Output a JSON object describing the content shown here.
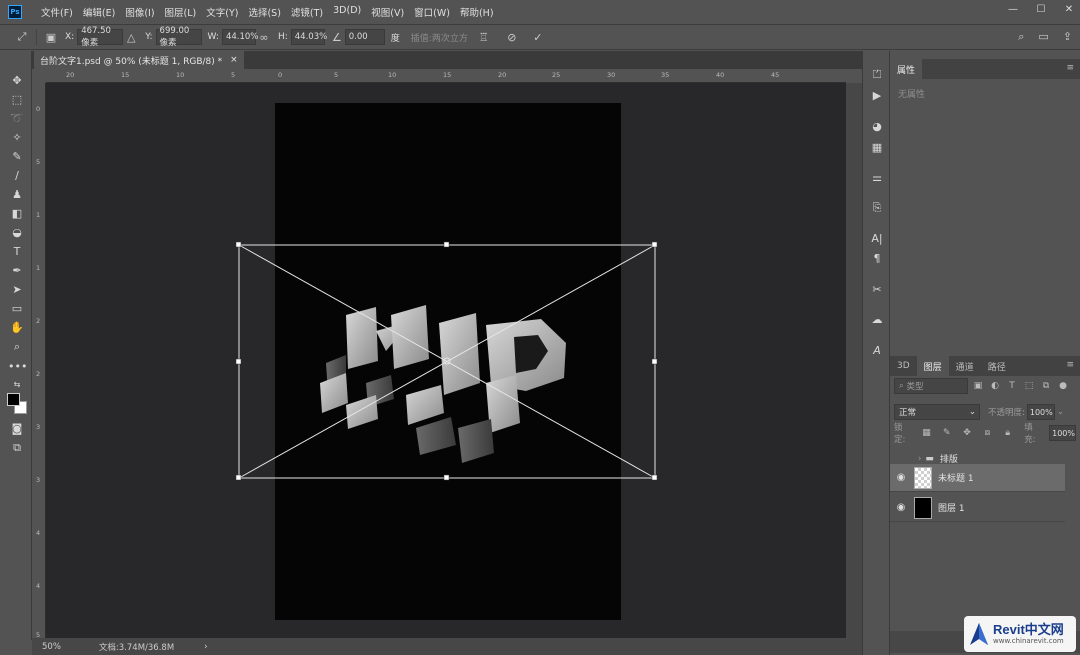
{
  "app": {
    "logo": "Ps"
  },
  "menu": [
    "文件(F)",
    "编辑(E)",
    "图像(I)",
    "图层(L)",
    "文字(Y)",
    "选择(S)",
    "滤镜(T)",
    "3D(D)",
    "视图(V)",
    "窗口(W)",
    "帮助(H)"
  ],
  "window_controls": {
    "minimize": "—",
    "maximize": "☐",
    "close": "✕"
  },
  "options": {
    "x_label": "X:",
    "x_value": "467.50 像素",
    "y_label": "Y:",
    "y_value": "699.00 像素",
    "w_label": "W:",
    "w_value": "44.10%",
    "h_label": "H:",
    "h_value": "44.03%",
    "angle_value": "0.00",
    "angle_unit": "度",
    "interp_label": "插值:两次立方"
  },
  "document_tab": {
    "title": "台阶文字1.psd @ 50% (未标题 1, RGB/8) *",
    "close": "×"
  },
  "ruler": {
    "top": [
      "20",
      "15",
      "10",
      "5",
      "0",
      "5",
      "10",
      "15",
      "20",
      "25",
      "30",
      "35",
      "40",
      "45"
    ],
    "left": [
      "0",
      "5",
      "1",
      "1",
      "2",
      "2",
      "3",
      "3",
      "4",
      "4",
      "5"
    ]
  },
  "status": {
    "zoom": "50%",
    "doc_info": "文档:3.74M/36.8M",
    "arrow": "›"
  },
  "properties": {
    "tab": "属性",
    "empty": "无属性"
  },
  "layers_panel": {
    "tabs": [
      "3D",
      "图层",
      "通道",
      "路径"
    ],
    "active_tab": "图层",
    "search_placeholder": "类型",
    "blend_mode": "正常",
    "opacity_label": "不透明度:",
    "opacity_value": "100%",
    "lock_label": "锁定:",
    "fill_label": "填充:",
    "fill_value": "100%",
    "layers": [
      {
        "name": "排版",
        "kind": "group",
        "visible": false,
        "selected": false
      },
      {
        "name": "未标题 1",
        "kind": "smart",
        "visible": true,
        "selected": true
      },
      {
        "name": "图层 1",
        "kind": "fill",
        "visible": true,
        "selected": false
      }
    ]
  },
  "watermark": {
    "title": "Revit中文网",
    "url": "www.chinarevit.com"
  },
  "colors": {
    "accent": "#31a8ff",
    "ui_bg": "#535353",
    "canvas_bg": "#28282a",
    "doc_bg": "#050505"
  }
}
